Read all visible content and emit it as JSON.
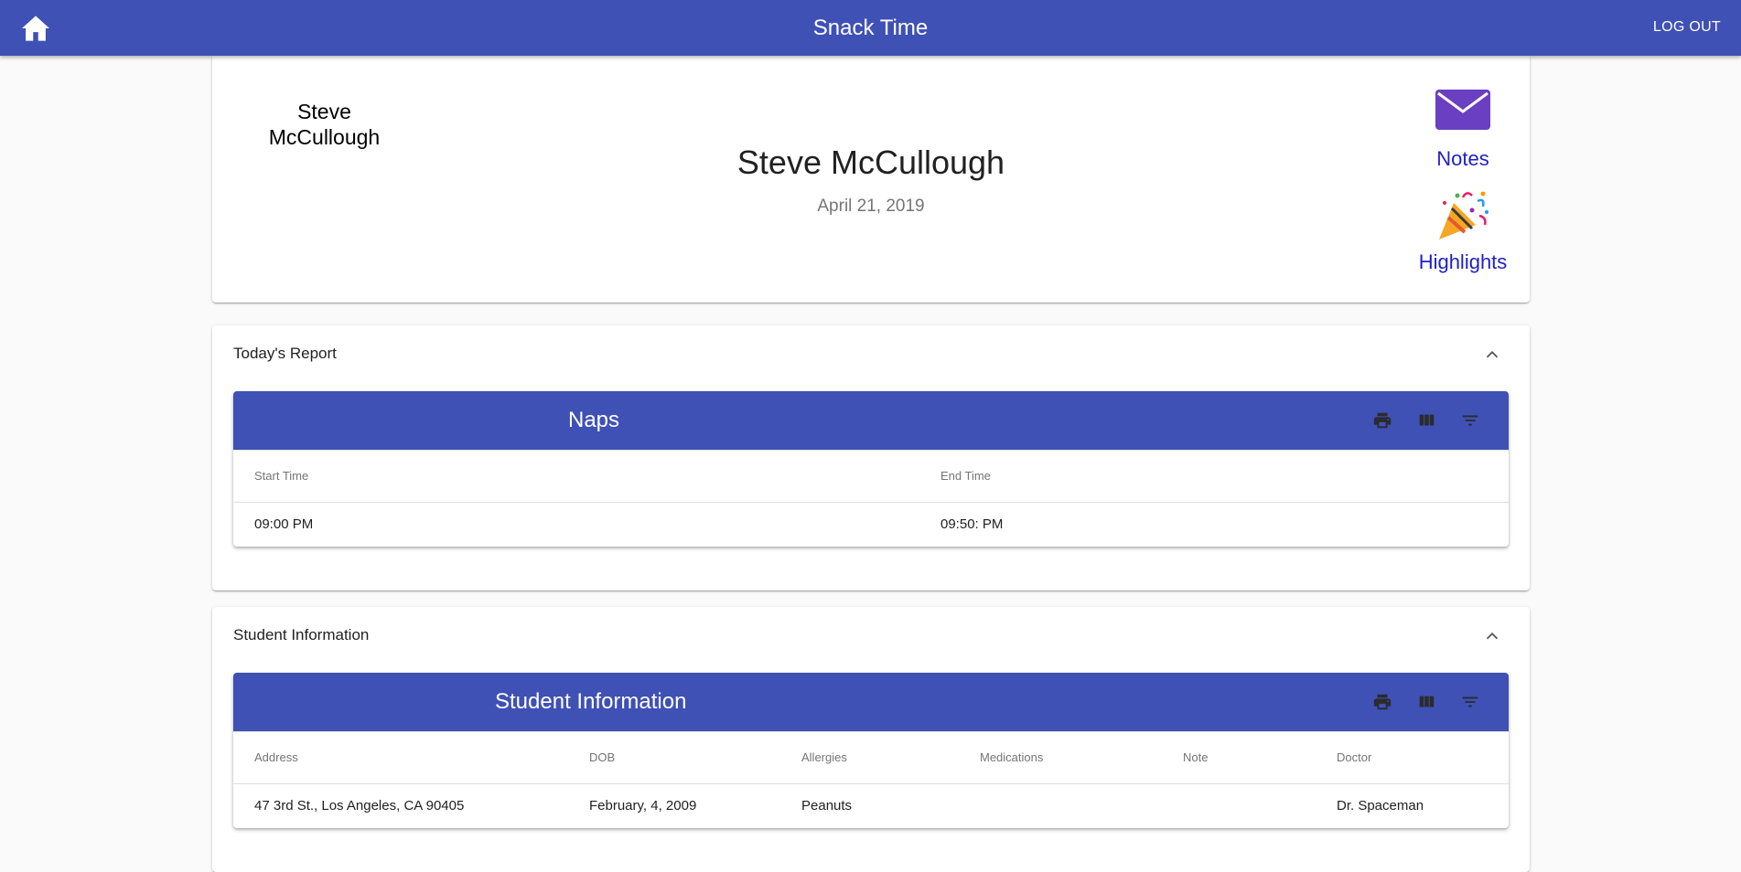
{
  "appbar": {
    "title": "Snack Time",
    "logout_label": "LOG OUT",
    "home_icon": "home-icon",
    "color": "#3f51b5"
  },
  "profile": {
    "avatar_name": "Steve McCullough",
    "name": "Steve McCullough",
    "date": "April 21, 2019",
    "notes_label": "Notes",
    "notes_icon": "envelope-icon",
    "highlights_label": "Highlights",
    "highlights_icon": "party-popper-icon"
  },
  "todays_report": {
    "heading": "Today's Report",
    "table": {
      "title": "Naps",
      "columns": [
        "Start Time",
        "End Time"
      ],
      "rows": [
        [
          "09:00 PM",
          "09:50: PM"
        ]
      ]
    }
  },
  "student_info": {
    "heading": "Student Information",
    "table": {
      "title": "Student Information",
      "columns": [
        "Address",
        "DOB",
        "Allergies",
        "Medications",
        "Note",
        "Doctor"
      ],
      "rows": [
        [
          "47 3rd St., Los Angeles, CA 90405",
          "February, 4, 2009",
          "Peanuts",
          "",
          "",
          "Dr. Spaceman"
        ]
      ]
    }
  },
  "table_toolbar_icons": [
    "print-icon",
    "view-column-icon",
    "filter-icon"
  ]
}
